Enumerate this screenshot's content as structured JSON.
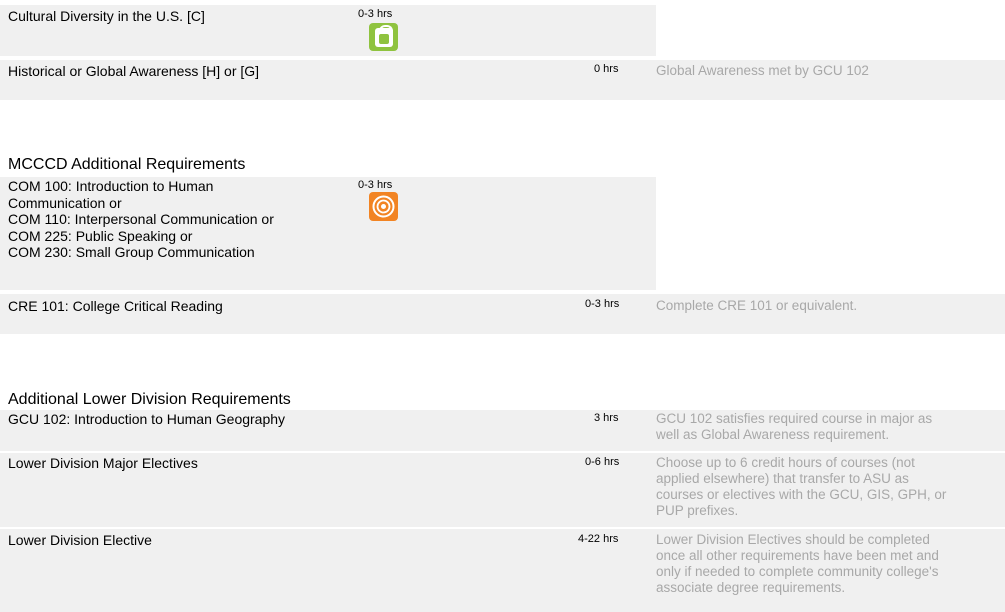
{
  "rows": [
    {
      "name": "Cultural Diversity in the U.S. [C]",
      "hours": "0-3 hrs",
      "note": "",
      "icon": "cultural-diversity-icon"
    },
    {
      "name": "Historical or Global Awareness [H] or [G]",
      "hours": "0 hrs",
      "note": "Global Awareness met by GCU 102"
    }
  ],
  "mcccd": {
    "title": "MCCCD Additional Requirements",
    "com_lines": [
      "COM 100: Introduction to Human",
      "Communication or",
      "COM 110: Interpersonal Communication or",
      "COM 225: Public Speaking or",
      "COM 230: Small Group Communication"
    ],
    "com_hours": "0-3 hrs",
    "com_icon": "communication-icon",
    "cre": {
      "name": "CRE 101: College Critical Reading",
      "hours": "0-3 hrs",
      "note": "Complete CRE 101 or equivalent."
    }
  },
  "additional": {
    "title": "Additional Lower Division Requirements",
    "rows": [
      {
        "name": "GCU 102: Introduction to Human Geography",
        "hours": "3 hrs",
        "note_lines": [
          "GCU 102 satisfies required course in major as",
          "well as Global Awareness requirement."
        ]
      },
      {
        "name": "Lower Division Major Electives",
        "hours": "0-6 hrs",
        "note_lines": [
          "Choose up to 6 credit hours of courses (not",
          "applied elsewhere) that transfer to ASU as",
          "courses or electives with the GCU, GIS, GPH, or",
          "PUP prefixes."
        ]
      },
      {
        "name": "Lower Division Elective",
        "hours": "4-22 hrs",
        "note_lines": [
          "Lower Division Electives should be completed",
          "once all other requirements have been met and",
          "only if needed to complete community college's",
          "associate degree requirements."
        ]
      }
    ]
  },
  "colors": {
    "row_bg": "#f0f0f0",
    "note_text": "#a8a8a8",
    "icon_cultural": "#8fc33f",
    "icon_com": "#f28423"
  }
}
